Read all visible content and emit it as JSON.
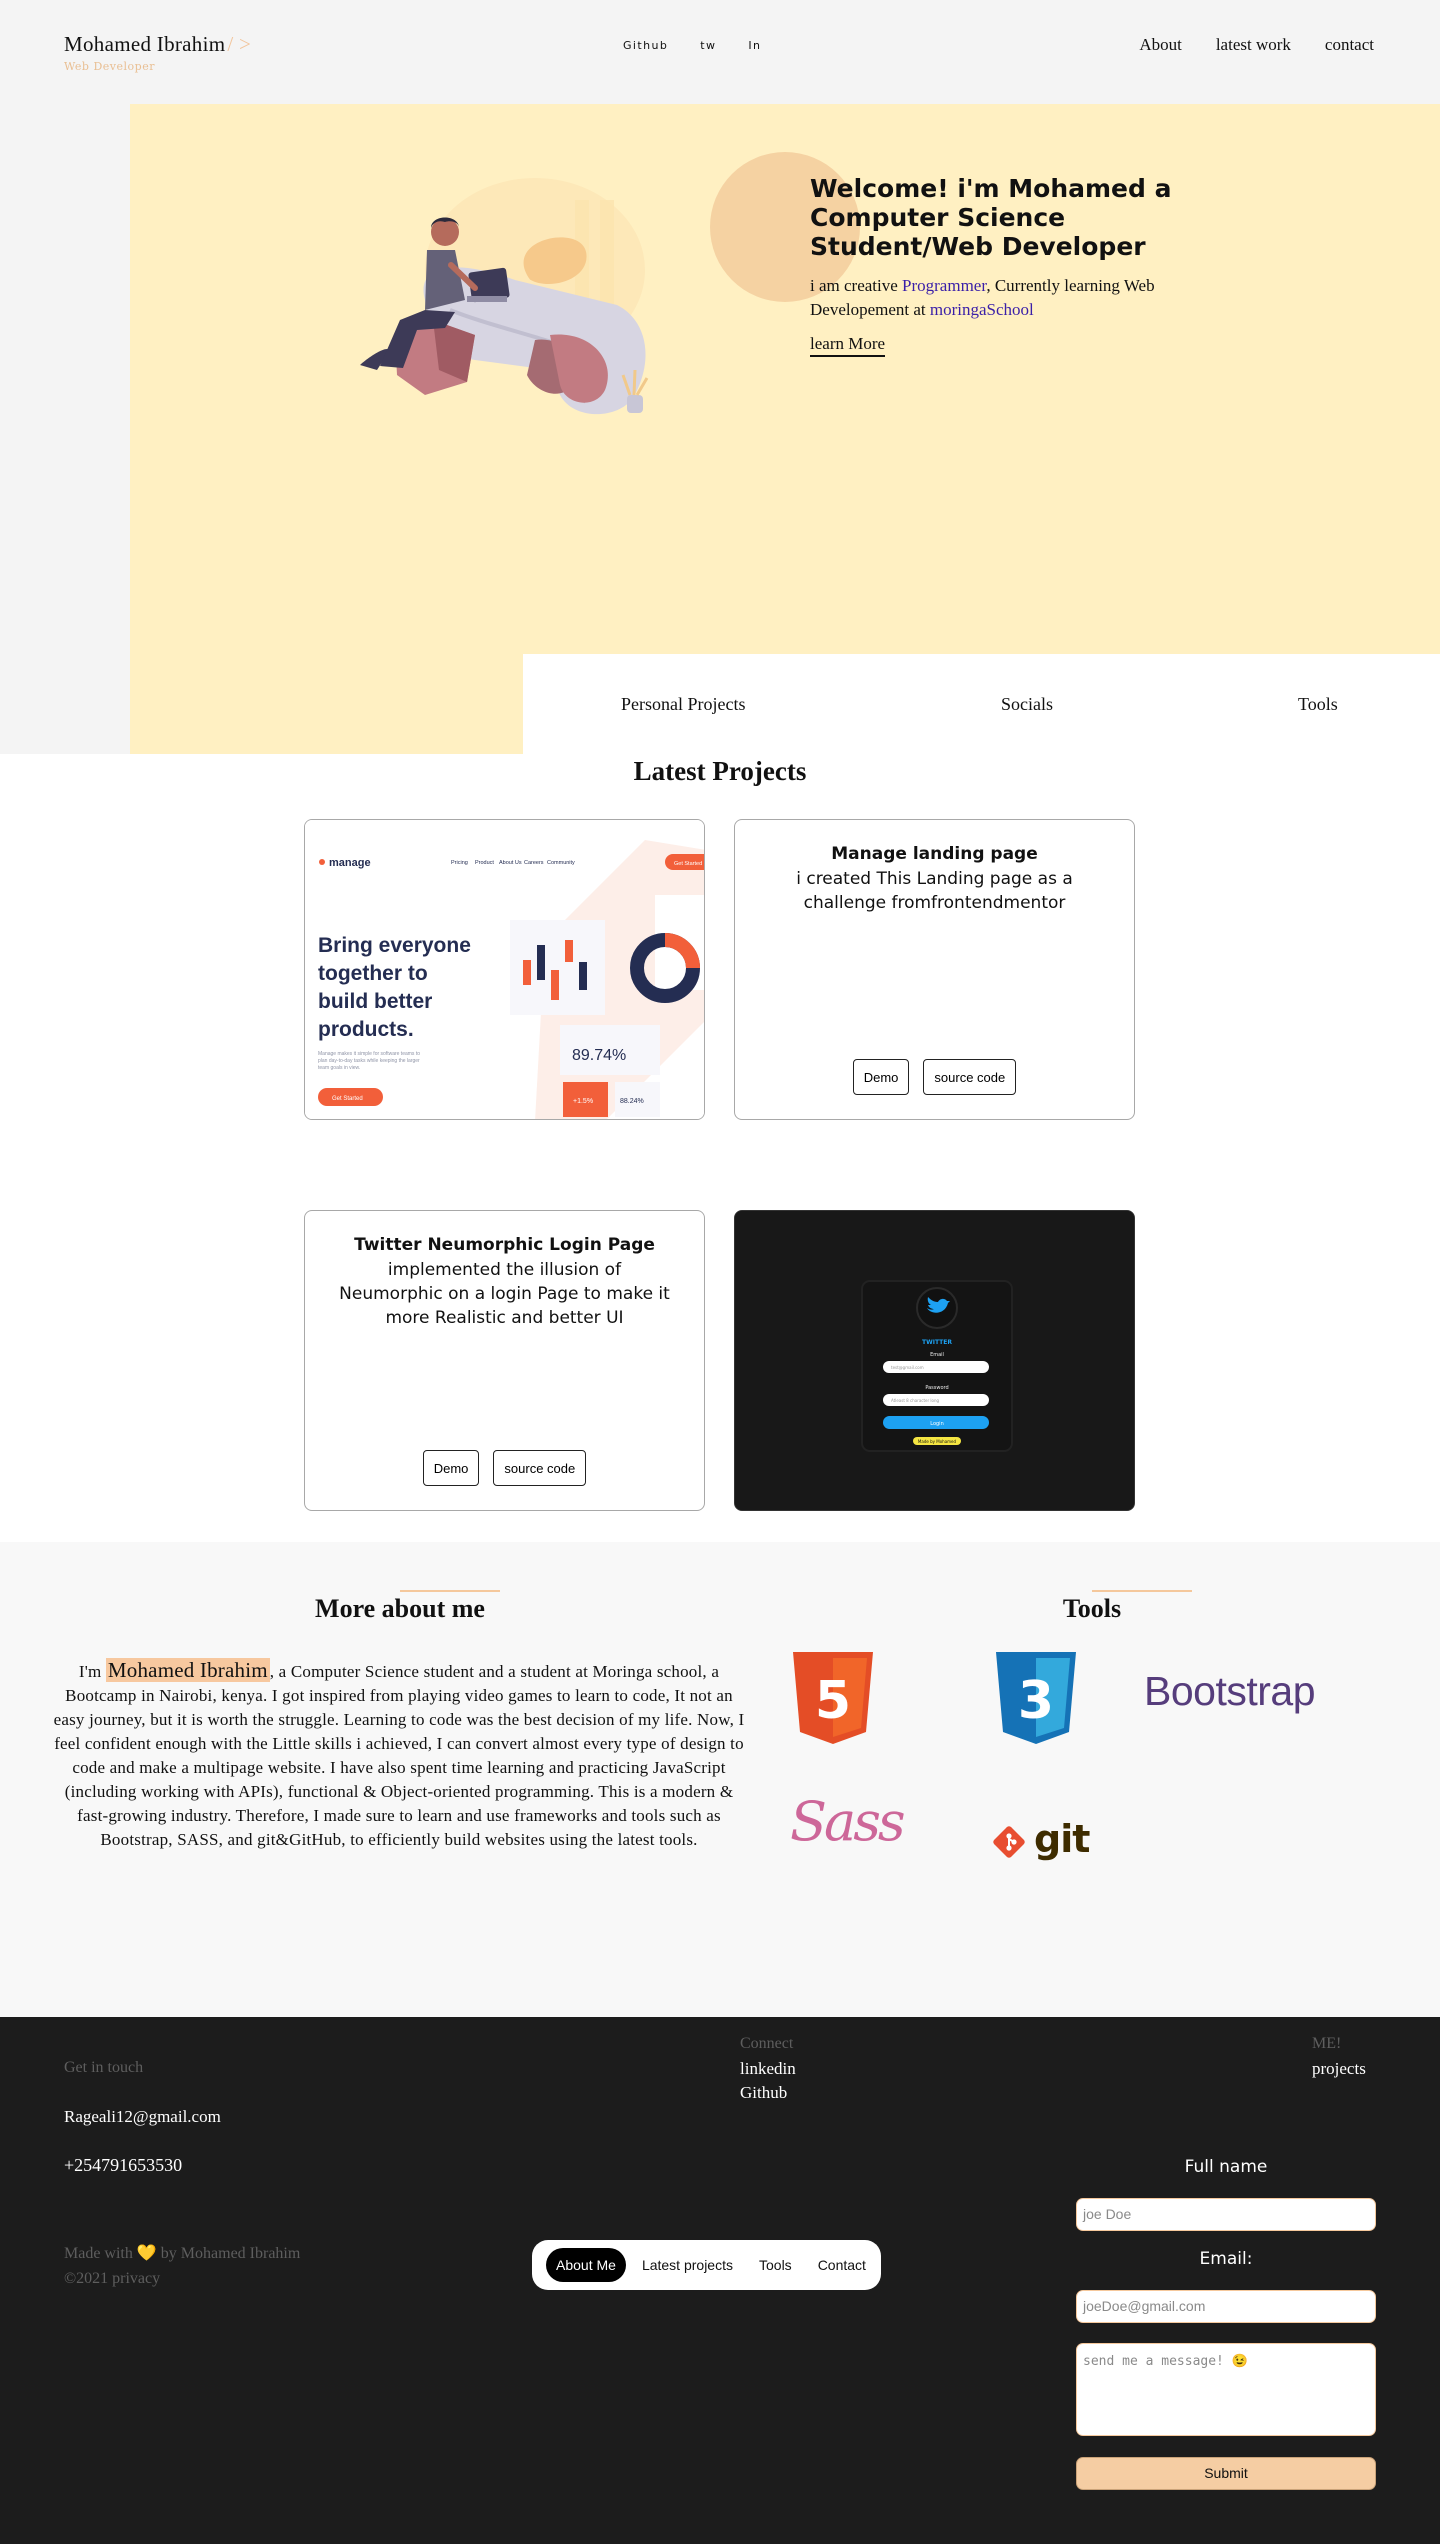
{
  "header": {
    "brand_name": "Mohamed Ibrahim",
    "brand_slash": "/ >",
    "brand_role": "Web Developer",
    "social": [
      "Github",
      "tw",
      "In"
    ],
    "nav": [
      "About",
      "latest work",
      "contact"
    ]
  },
  "hero": {
    "title": "Welcome! i'm Mohamed a Computer Science Student/Web Developer",
    "text_1": "i am creative ",
    "text_hl1": "Programmer",
    "text_2": ", Currently learning Web Developement at ",
    "text_hl2": "moringaSchool",
    "learn_more": "learn More"
  },
  "tabs": [
    "Personal Projects",
    "Socials",
    "Tools"
  ],
  "projects": {
    "title": "Latest Projects",
    "manage_preview": {
      "logo": "manage",
      "nav": [
        "Pricing",
        "Product",
        "About Us",
        "Careers",
        "Community"
      ],
      "cta": "Get Started",
      "headline": "Bring everyone together to build better products.",
      "sub": "Manage makes it simple for software teams to plan day-to-day tasks while keeping the larger team goals in view.",
      "button": "Get Started",
      "stat_main": "89.74%",
      "stat_a": "+1.5%",
      "stat_b": "88.24%"
    },
    "card1": {
      "title": "Manage landing page",
      "desc": "i created This Landing page as a challenge fromfrontendmentor",
      "demo": "Demo",
      "source": "source code"
    },
    "card2": {
      "title": "Twitter Neumorphic Login Page",
      "desc": "implemented the illusion of Neumorphic on a login Page to make it more Realistic and better UI",
      "demo": "Demo",
      "source": "source code"
    },
    "twitter_preview": {
      "heading": "TWITTER",
      "email_label": "Email",
      "email_ph": "test@gmail.com",
      "password_label": "Password",
      "password_ph": "Atleast 8 character long",
      "login": "Login",
      "forgot": "Made by Mohamed"
    }
  },
  "about": {
    "title": "More about me",
    "lead": "I'm ",
    "name": "Mohamed Ibrahim",
    "body": ", a Computer Science student and a student at Moringa school, a Bootcamp in Nairobi, kenya. I got inspired from playing video games to learn to code, It not an easy journey, but it is worth the struggle. Learning to code was the best decision of my life. Now, I feel confident enough with the Little skills i achieved, I can convert almost every type of design to code and make a multipage website. I have also spent time learning and practicing JavaScript (including working with APIs), functional & Object-oriented programming. This is a modern & fast-growing industry. Therefore, I made sure to learn and use frameworks and tools such as Bootstrap, SASS, and git&GitHub, to efficiently build websites using the latest tools."
  },
  "tools": {
    "title": "Tools",
    "html_num": "5",
    "css_num": "3",
    "bootstrap": "Bootstrap",
    "sass": "Sass",
    "git": "git"
  },
  "footer": {
    "get_in_touch": "Get in touch",
    "email": "Rageali12@gmail.com",
    "phone": "+254791653530",
    "made_with": "Made with ",
    "made_by": " by Mohamed Ibrahim",
    "copyright": "©2021 privacy",
    "connect": "Connect",
    "linkedin": "linkedin",
    "github": "Github",
    "me": "ME!",
    "projects": "projects",
    "pill_nav": [
      "About Me",
      "Latest projects",
      "Tools",
      "Contact"
    ]
  },
  "form": {
    "name_label": "Full name",
    "name_ph": "joe Doe",
    "email_label": "Email:",
    "email_ph": "joeDoe@gmail.com",
    "message_ph": "send me a message! 😉",
    "submit": "Submit"
  },
  "colors": {
    "accent": "#f5c89c",
    "hero_bg": "#fff0c2",
    "footer_bg": "#1c1c1c",
    "link": "#3a1fa8"
  }
}
